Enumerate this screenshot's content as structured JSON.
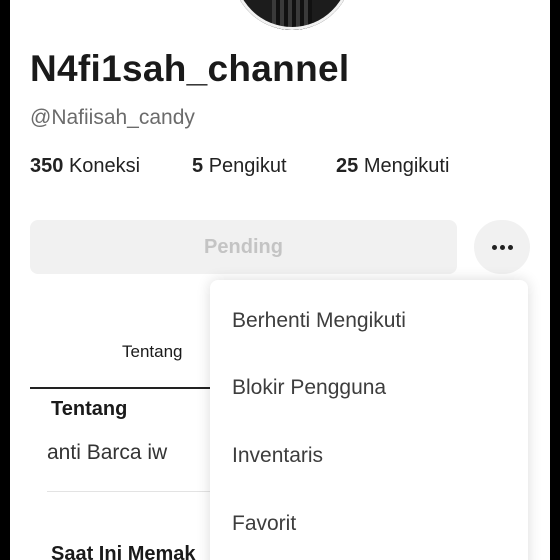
{
  "profile": {
    "display_name": "N4fi1sah_channel",
    "username": "@Nafiisah_candy",
    "stats": [
      {
        "value": "350",
        "label": "Koneksi"
      },
      {
        "value": "5",
        "label": "Pengikut"
      },
      {
        "value": "25",
        "label": "Mengikuti"
      }
    ],
    "pending_label": "Pending",
    "more_icon": "more-horizontal-icon"
  },
  "tabs": {
    "about_label": "Tentang"
  },
  "about": {
    "title": "Tentang",
    "bio": "anti Barca iw",
    "next_section": "Saat Ini Memak"
  },
  "menu": {
    "items": [
      {
        "label": "Berhenti Mengikuti"
      },
      {
        "label": "Blokir Pengguna"
      },
      {
        "label": "Inventaris"
      },
      {
        "label": "Favorit"
      }
    ]
  }
}
